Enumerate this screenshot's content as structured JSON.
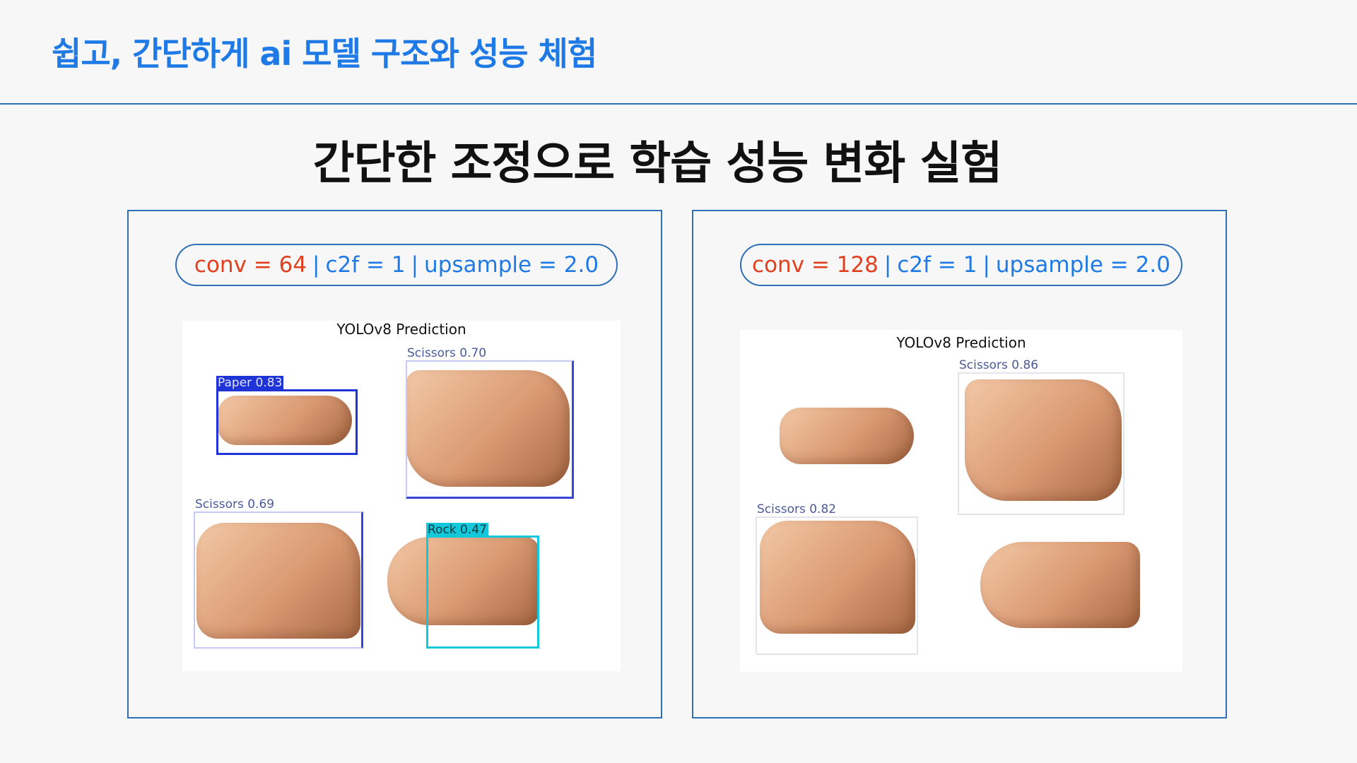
{
  "header": {
    "title": "쉽고, 간단하게 ai 모델 구조와 성능 체험"
  },
  "main": {
    "title": "간단한 조정으로 학습 성능 변화 실험"
  },
  "panels": [
    {
      "config": {
        "conv": "conv = 64",
        "sep1": "|",
        "c2f": "c2f = 1",
        "sep2": "|",
        "upsample": "upsample = 2.0"
      },
      "figure_title": "YOLOv8 Prediction",
      "detections": [
        {
          "label": "Paper 0.83"
        },
        {
          "label": "Scissors 0.70"
        },
        {
          "label": "Scissors 0.69"
        },
        {
          "label": "Rock 0.47"
        }
      ]
    },
    {
      "config": {
        "conv": "conv = 128",
        "sep1": "|",
        "c2f": "c2f = 1",
        "sep2": "|",
        "upsample": "upsample = 2.0"
      },
      "figure_title": "YOLOv8 Prediction",
      "detections": [
        {
          "label": "Scissors 0.86"
        },
        {
          "label": "Scissors 0.82"
        }
      ]
    }
  ],
  "colors": {
    "accent_blue": "#1f7ae6",
    "border_blue": "#2f6fb7",
    "conv_orange": "#e0401e",
    "paper_box": "#1f34d6",
    "scissors_box": "#c7c9f5",
    "rock_box": "#14c8dc"
  }
}
